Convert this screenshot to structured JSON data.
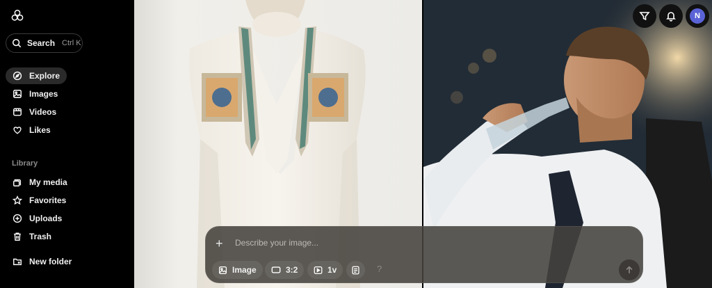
{
  "sidebar": {
    "search": {
      "label": "Search",
      "shortcut": "Ctrl K"
    },
    "nav": [
      {
        "label": "Explore",
        "icon": "compass-icon",
        "active": true
      },
      {
        "label": "Images",
        "icon": "image-icon"
      },
      {
        "label": "Videos",
        "icon": "video-icon"
      },
      {
        "label": "Likes",
        "icon": "heart-icon"
      }
    ],
    "library_title": "Library",
    "library": [
      {
        "label": "My media",
        "icon": "media-icon"
      },
      {
        "label": "Favorites",
        "icon": "star-icon"
      },
      {
        "label": "Uploads",
        "icon": "upload-icon"
      },
      {
        "label": "Trash",
        "icon": "trash-icon"
      }
    ],
    "new_folder": {
      "label": "New folder",
      "icon": "folder-plus-icon"
    }
  },
  "header": {
    "avatar_initial": "N"
  },
  "composer": {
    "placeholder": "Describe your image...",
    "mode_label": "Image",
    "aspect_label": "3:2",
    "version_label": "1v",
    "help_label": "?"
  },
  "colors": {
    "accent_avatar": "#5a63d6",
    "sidebar_bg": "#000000",
    "composer_bg": "#46423e"
  }
}
